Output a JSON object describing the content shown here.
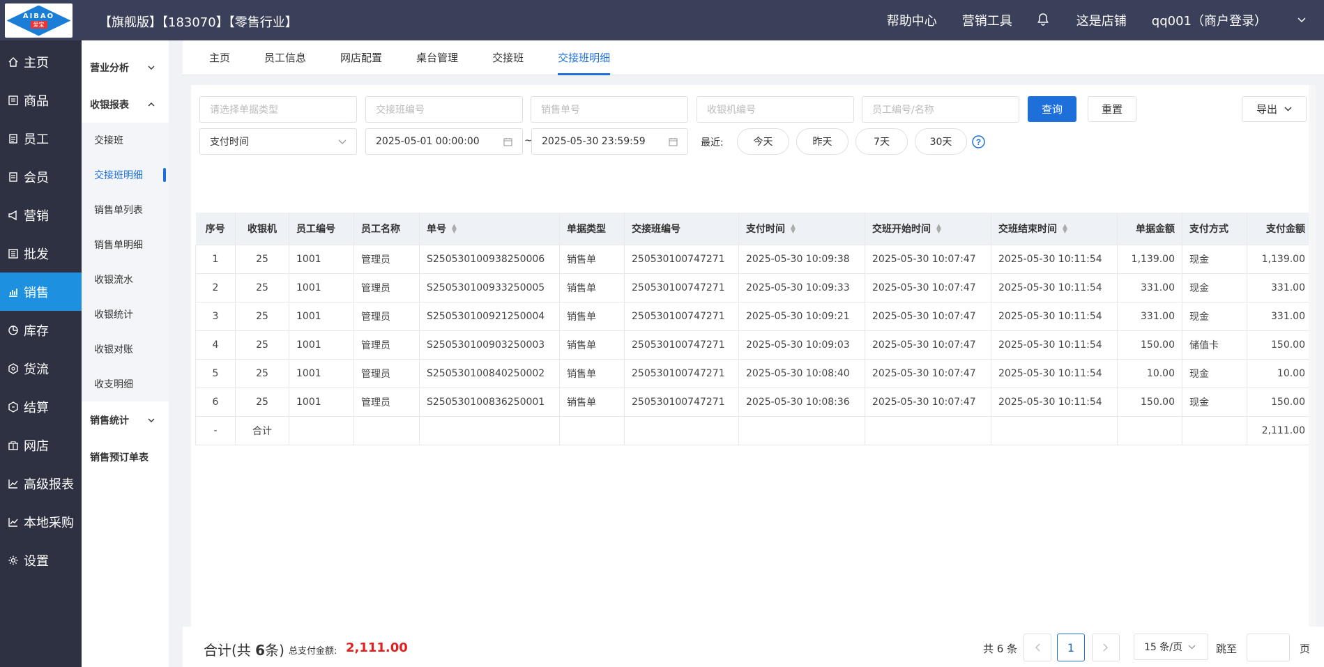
{
  "header": {
    "logo_text": "AIBAO",
    "logo_sub": "爱宝",
    "edition": "【旗舰版】【183070】【零售行业】",
    "nav": [
      "帮助中心",
      "营销工具",
      "这是店铺"
    ],
    "user": "qq001（商户登录）"
  },
  "sidebar": [
    {
      "label": "主页",
      "icon": "home-icon"
    },
    {
      "label": "商品",
      "icon": "goods-icon"
    },
    {
      "label": "员工",
      "icon": "employee-icon"
    },
    {
      "label": "会员",
      "icon": "member-icon"
    },
    {
      "label": "营销",
      "icon": "megaphone-icon"
    },
    {
      "label": "批发",
      "icon": "wholesale-icon"
    },
    {
      "label": "销售",
      "icon": "chart-icon",
      "active": true
    },
    {
      "label": "库存",
      "icon": "stock-icon"
    },
    {
      "label": "货流",
      "icon": "flow-icon"
    },
    {
      "label": "结算",
      "icon": "settle-icon"
    },
    {
      "label": "网店",
      "icon": "shop-icon"
    },
    {
      "label": "高级报表",
      "icon": "report-icon"
    },
    {
      "label": "本地采购",
      "icon": "purchase-icon"
    },
    {
      "label": "设置",
      "icon": "gear-icon"
    }
  ],
  "submenu": {
    "group1": "营业分析",
    "group2": "收银报表",
    "items": [
      "交接班",
      "交接班明细",
      "销售单列表",
      "销售单明细",
      "收银流水",
      "收银统计",
      "收银对账",
      "收支明细"
    ],
    "group3": "销售统计",
    "group4": "销售预订单表"
  },
  "tabs": [
    "主页",
    "员工信息",
    "网店配置",
    "桌台管理",
    "交接班",
    "交接班明细"
  ],
  "filters": {
    "doc_type_ph": "请选择单据类型",
    "shift_no_ph": "交接班编号",
    "sale_no_ph": "销售单号",
    "cashier_ph": "收银机编号",
    "employee_ph": "员工编号/名称",
    "query": "查询",
    "reset": "重置",
    "export": "导出",
    "time_type": "支付时间",
    "start": "2025-05-01 00:00:00",
    "end": "2025-05-30 23:59:59",
    "tilde": "~",
    "recent": "最近:",
    "quick": [
      "今天",
      "昨天",
      "7天",
      "30天"
    ]
  },
  "table": {
    "headers": [
      "序号",
      "收银机",
      "员工编号",
      "员工名称",
      "单号",
      "单据类型",
      "交接班编号",
      "支付时间",
      "交班开始时间",
      "交班结束时间",
      "单据金额",
      "支付方式",
      "支付金额"
    ],
    "rows": [
      [
        "1",
        "25",
        "1001",
        "管理员",
        "S250530100938250006",
        "销售单",
        "250530100747271",
        "2025-05-30 10:09:38",
        "2025-05-30 10:07:47",
        "2025-05-30 10:11:54",
        "1,139.00",
        "现金",
        "1,139.00"
      ],
      [
        "2",
        "25",
        "1001",
        "管理员",
        "S250530100933250005",
        "销售单",
        "250530100747271",
        "2025-05-30 10:09:33",
        "2025-05-30 10:07:47",
        "2025-05-30 10:11:54",
        "331.00",
        "现金",
        "331.00"
      ],
      [
        "3",
        "25",
        "1001",
        "管理员",
        "S250530100921250004",
        "销售单",
        "250530100747271",
        "2025-05-30 10:09:21",
        "2025-05-30 10:07:47",
        "2025-05-30 10:11:54",
        "331.00",
        "现金",
        "331.00"
      ],
      [
        "4",
        "25",
        "1001",
        "管理员",
        "S250530100903250003",
        "销售单",
        "250530100747271",
        "2025-05-30 10:09:03",
        "2025-05-30 10:07:47",
        "2025-05-30 10:11:54",
        "150.00",
        "储值卡",
        "150.00"
      ],
      [
        "5",
        "25",
        "1001",
        "管理员",
        "S250530100840250002",
        "销售单",
        "250530100747271",
        "2025-05-30 10:08:40",
        "2025-05-30 10:07:47",
        "2025-05-30 10:11:54",
        "10.00",
        "现金",
        "10.00"
      ],
      [
        "6",
        "25",
        "1001",
        "管理员",
        "S250530100836250001",
        "销售单",
        "250530100747271",
        "2025-05-30 10:08:36",
        "2025-05-30 10:07:47",
        "2025-05-30 10:11:54",
        "150.00",
        "现金",
        "150.00"
      ]
    ],
    "total_row": {
      "no": "-",
      "label": "合计",
      "amount": "2,111.00"
    }
  },
  "footer": {
    "sum_prefix": "合计(共 ",
    "sum_count": "6",
    "sum_suffix": "条)",
    "total_label": "总支付金额:",
    "total_amount": "2,111.00",
    "pg_total": "共 6 条",
    "current_page": "1",
    "page_size": "15 条/页",
    "jump": "跳至",
    "page": "页"
  },
  "colors": {
    "accent": "#1e6fd9",
    "header_bg": "#3a3f5a",
    "sidebar_bg": "#2d3142",
    "sidebar_active": "#1e90e0",
    "amount_red": "#e02020"
  }
}
